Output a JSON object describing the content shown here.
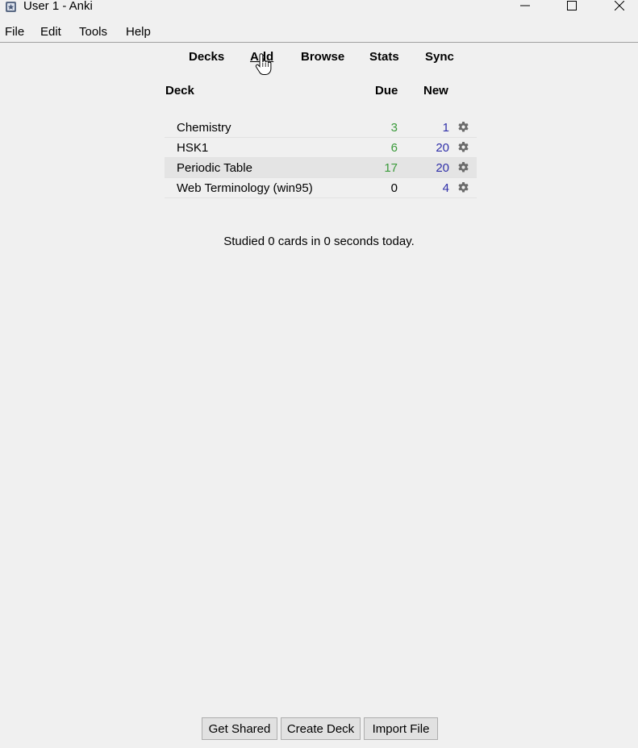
{
  "window": {
    "title": "User 1 - Anki",
    "app_icon": "anki-icon"
  },
  "menubar": {
    "items": [
      "File",
      "Edit",
      "Tools",
      "Help"
    ]
  },
  "toplinks": [
    "Decks",
    "Add",
    "Browse",
    "Stats",
    "Sync"
  ],
  "deck_table": {
    "headers": {
      "deck": "Deck",
      "due": "Due",
      "new": "New"
    },
    "rows": [
      {
        "name": "Chemistry",
        "due": "3",
        "new": "1"
      },
      {
        "name": "HSK1",
        "due": "6",
        "new": "20"
      },
      {
        "name": "Periodic Table",
        "due": "17",
        "new": "20"
      },
      {
        "name": "Web Terminology (win95)",
        "due": "0",
        "new": "4"
      }
    ]
  },
  "studied_text": "Studied 0 cards in 0 seconds today.",
  "bottom_buttons": [
    "Get Shared",
    "Create Deck",
    "Import File"
  ],
  "colors": {
    "due_positive": "#3a9a3a",
    "due_zero": "#000000",
    "new": "#2f2fa8",
    "gear": "#6b6b6b"
  }
}
